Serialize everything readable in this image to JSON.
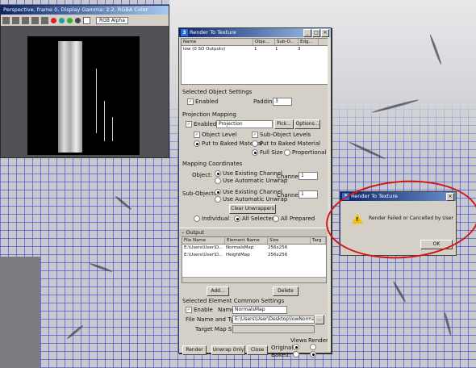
{
  "frame_window": {
    "title": "Perspective, frame 0, Display Gamma: 2.2, RGBA Color",
    "channel": "RGB Alpha",
    "dot_colors": [
      "#e02020",
      "#20a0a0",
      "#30b030"
    ]
  },
  "rtt": {
    "title": "Render To Texture",
    "close_glyph": "×",
    "min_glyph": "_",
    "max_glyph": "□",
    "obj_table": {
      "headers": [
        "Name",
        "Obje...",
        "Sub-O...",
        "Edg..."
      ],
      "rows": [
        [
          "low (0 SO Outputs)",
          "1",
          "1",
          "3"
        ]
      ]
    },
    "selected_object_settings": "Selected Object Settings",
    "enabled_label": "Enabled",
    "padding_label": "Padding:",
    "padding_value": "3",
    "projection_mapping": "Projection Mapping",
    "pm_enabled": "Enabled",
    "projection_value": "Projection",
    "pick_label": "Pick...",
    "options_label": "Options...",
    "object_level": "Object Level",
    "sub_object_levels": "Sub-Object Levels",
    "put_to_baked_1": "Put to Baked Material",
    "put_to_baked_2": "Put to Baked Material",
    "full_size": "Full Size",
    "proportional": "Proportional",
    "mapping_coordinates": "Mapping Coordinates",
    "object_label": "Object:",
    "use_existing": "Use Existing Channel",
    "use_auto": "Use Automatic Unwrap",
    "channel_label": "Channel:",
    "channel_value": "1",
    "subobjects_label": "Sub-Objects:",
    "use_existing_2": "Use Existing Channel",
    "use_auto_2": "Use Automatic Unwrap",
    "channel_label_2": "Channel:",
    "channel_value_2": "1",
    "clear_unwrappers": "Clear Unwrappers",
    "individual": "Individual",
    "all_selected": "All Selected",
    "all_prepared": "All Prepared",
    "output_label": "Output",
    "out_headers": [
      "File Name",
      "Element Name",
      "Size",
      "Targ"
    ],
    "out_rows": [
      [
        "E:\\Users\\User\\D...",
        "NormalsMap",
        "256x256"
      ],
      [
        "E:\\Users\\User\\D...",
        "HeightMap",
        "256x256"
      ]
    ],
    "add_label": "Add...",
    "delete_label": "Delete",
    "sel_elem_settings": "Selected Element Common Settings",
    "enable_label": "Enable",
    "name_label": "Name:",
    "name_value": "NormalsMap",
    "file_name_type_label": "File Name and Type:",
    "file_name_value": "E:\\Users\\User\\Desktop\\lowNormals",
    "browse_label": "...",
    "target_map_slot": "Target Map Slot:",
    "render_label": "Render",
    "unwrap_only_label": "Unwrap Only",
    "close_label": "Close",
    "views_label": "Views",
    "render_col_label": "Render",
    "original_label": "Original:",
    "baked_label": "Baked:"
  },
  "error_dialog": {
    "title": "Render To Texture",
    "close_glyph": "×",
    "message": "Render Failed or Cancelled by User",
    "ok_label": "OK",
    "warn_glyph": "!"
  }
}
